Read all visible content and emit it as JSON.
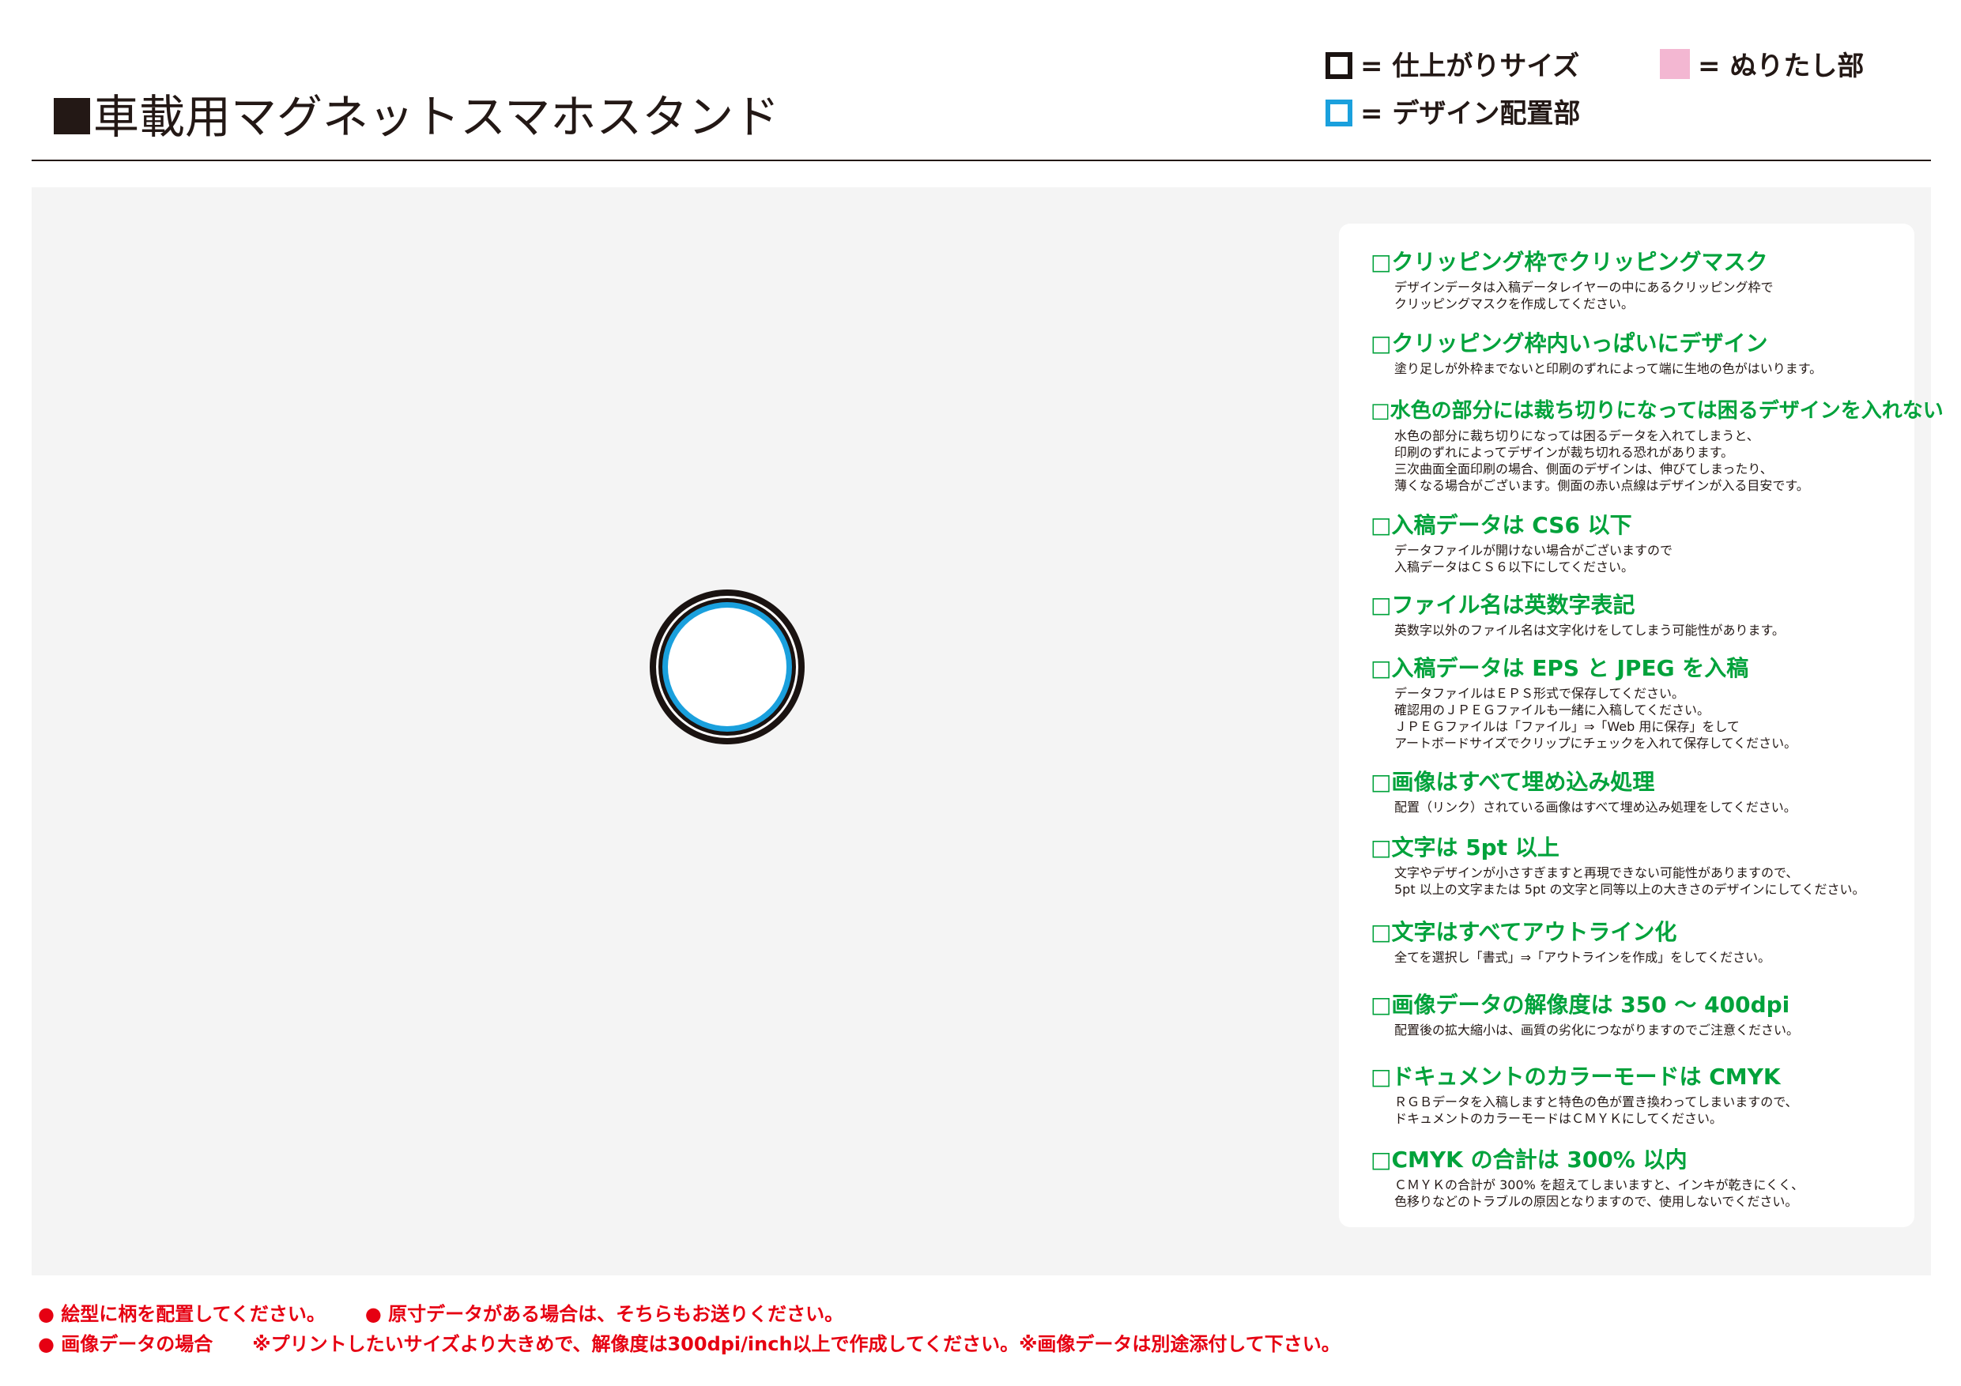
{
  "header": {
    "title": "車載用マグネットスマホスタンド"
  },
  "legend": {
    "finish_size": "= 仕上がりサイズ",
    "design_area": "= デザイン配置部",
    "bleed": "= ぬりたし部",
    "colors": {
      "finish": "#1a1311",
      "design": "#1aa0dd",
      "bleed": "#f3b7d2"
    }
  },
  "checklist": {
    "heading_color": "#00a23b",
    "items": [
      {
        "head": "□クリッピング枠でクリッピングマスク",
        "body": [
          "デザインデータは入稿データレイヤーの中にあるクリッピング枠で",
          "クリッピングマスクを作成してください。"
        ]
      },
      {
        "head": "□クリッピング枠内いっぱいにデザイン",
        "body": [
          "塗り足しが外枠までないと印刷のずれによって端に生地の色がはいります。"
        ]
      },
      {
        "head": "□水色の部分には裁ち切りになっては困るデザインを入れない",
        "body": [
          "水色の部分に裁ち切りになっては困るデータを入れてしまうと、",
          "印刷のずれによってデザインが裁ち切れる恐れがあります。",
          "三次曲面全面印刷の場合、側面のデザインは、伸びてしまったり、",
          "薄くなる場合がございます。側面の赤い点線はデザインが入る目安です。"
        ]
      },
      {
        "head": "□入稿データは CS6 以下",
        "body": [
          "データファイルが開けない場合がございますので",
          "入稿データはＣＳ６以下にしてください。"
        ]
      },
      {
        "head": "□ファイル名は英数字表記",
        "body": [
          "英数字以外のファイル名は文字化けをしてしまう可能性があります。"
        ]
      },
      {
        "head": "□入稿データは EPS と JPEG を入稿",
        "body": [
          "データファイルはＥＰＳ形式で保存してください。",
          "確認用のＪＰＥＧファイルも一緒に入稿してください。",
          "ＪＰＥＧファイルは「ファイル」⇒「Web 用に保存」をして",
          "アートボードサイズでクリップにチェックを入れて保存してください。"
        ]
      },
      {
        "head": "□画像はすべて埋め込み処理",
        "body": [
          "配置（リンク）されている画像はすべて埋め込み処理をしてください。"
        ]
      },
      {
        "head": "□文字は 5pt 以上",
        "body": [
          "文字やデザインが小さすぎますと再現できない可能性がありますので、",
          "5pt 以上の文字または 5pt の文字と同等以上の大きさのデザインにしてください。"
        ]
      },
      {
        "head": "□文字はすべてアウトライン化",
        "body": [
          "全てを選択し「書式」⇒「アウトラインを作成」をしてください。"
        ]
      },
      {
        "head": "□画像データの解像度は 350 ～ 400dpi",
        "body": [
          "配置後の拡大縮小は、画質の劣化につながりますのでご注意ください。"
        ]
      },
      {
        "head": "□ドキュメントのカラーモードは CMYK",
        "body": [
          "ＲＧＢデータを入稿しますと特色の色が置き換わってしまいますので、",
          "ドキュメントのカラーモードはＣＭＹＫにしてください。"
        ]
      },
      {
        "head": "□CMYK の合計は 300% 以内",
        "body": [
          "ＣＭＹＫの合計が 300% を超えてしまいますと、インキが乾きにくく、",
          "色移りなどのトラブルの原因となりますので、使用しないでください。"
        ]
      }
    ]
  },
  "notes": {
    "color": "#e60012",
    "row1": [
      "● 絵型に柄を配置してください。",
      "● 原寸データがある場合は、そちらもお送りください。"
    ],
    "row2": [
      "● 画像データの場合",
      "※プリントしたいサイズより大きめで、解像度は300dpi/inch以上で作成してください。※画像データは別途添付して下さい。"
    ]
  }
}
